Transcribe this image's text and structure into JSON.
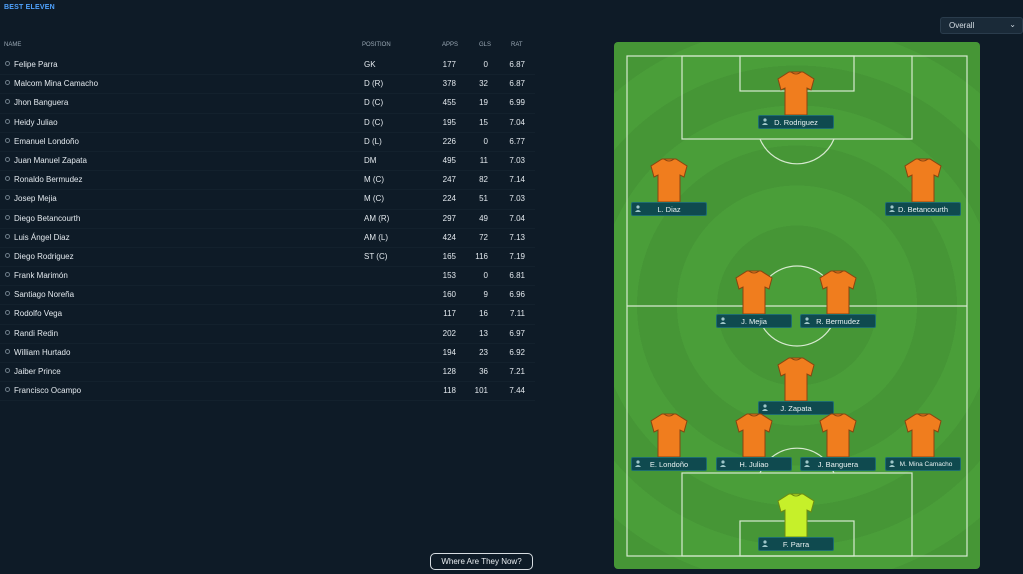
{
  "title": "BEST ELEVEN",
  "filter": {
    "selected": "Overall"
  },
  "columns": {
    "name": "NAME",
    "position": "POSITION",
    "apps": "APPS",
    "gls": "GLS",
    "rat": "RAT"
  },
  "players": [
    {
      "name": "Felipe Parra",
      "position": "GK",
      "apps": "177",
      "gls": "0",
      "rat": "6.87"
    },
    {
      "name": "Malcom Mina Camacho",
      "position": "D (R)",
      "apps": "378",
      "gls": "32",
      "rat": "6.87"
    },
    {
      "name": "Jhon Banguera",
      "position": "D (C)",
      "apps": "455",
      "gls": "19",
      "rat": "6.99"
    },
    {
      "name": "Heidy Juliao",
      "position": "D (C)",
      "apps": "195",
      "gls": "15",
      "rat": "7.04"
    },
    {
      "name": "Emanuel Londoño",
      "position": "D (L)",
      "apps": "226",
      "gls": "0",
      "rat": "6.77"
    },
    {
      "name": "Juan Manuel Zapata",
      "position": "DM",
      "apps": "495",
      "gls": "11",
      "rat": "7.03"
    },
    {
      "name": "Ronaldo Bermudez",
      "position": "M (C)",
      "apps": "247",
      "gls": "82",
      "rat": "7.14"
    },
    {
      "name": "Josep Mejia",
      "position": "M (C)",
      "apps": "224",
      "gls": "51",
      "rat": "7.03"
    },
    {
      "name": "Diego Betancourth",
      "position": "AM (R)",
      "apps": "297",
      "gls": "49",
      "rat": "7.04"
    },
    {
      "name": "Luis Ángel Diaz",
      "position": "AM (L)",
      "apps": "424",
      "gls": "72",
      "rat": "7.13"
    },
    {
      "name": "Diego Rodriguez",
      "position": "ST (C)",
      "apps": "165",
      "gls": "116",
      "rat": "7.19"
    },
    {
      "name": "Frank Marimón",
      "position": "",
      "apps": "153",
      "gls": "0",
      "rat": "6.81"
    },
    {
      "name": "Santiago Noreña",
      "position": "",
      "apps": "160",
      "gls": "9",
      "rat": "6.96"
    },
    {
      "name": "Rodolfo Vega",
      "position": "",
      "apps": "117",
      "gls": "16",
      "rat": "7.11"
    },
    {
      "name": "Randi Redin",
      "position": "",
      "apps": "202",
      "gls": "13",
      "rat": "6.97"
    },
    {
      "name": "William Hurtado",
      "position": "",
      "apps": "194",
      "gls": "23",
      "rat": "6.92"
    },
    {
      "name": "Jaiber Prince",
      "position": "",
      "apps": "128",
      "gls": "36",
      "rat": "7.21"
    },
    {
      "name": "Francisco Ocampo",
      "position": "",
      "apps": "118",
      "gls": "101",
      "rat": "7.44"
    }
  ],
  "pitch_players": {
    "st": "D. Rodriguez",
    "aml": "L. Diaz",
    "amr": "D. Betancourth",
    "mcl": "J. Mejia",
    "mcr": "R. Bermudez",
    "dm": "J. Zapata",
    "dl": "E. Londoño",
    "dcl": "H. Juliao",
    "dcr": "J. Banguera",
    "dr": "M. Mina Camacho",
    "gk": "F. Parra"
  },
  "colors": {
    "kit": "#f07d1e",
    "gk_kit": "#c6f02a",
    "pitch": "#4a9e39",
    "accent": "#4fa3ff"
  },
  "footer": {
    "button": "Where Are They Now?"
  }
}
